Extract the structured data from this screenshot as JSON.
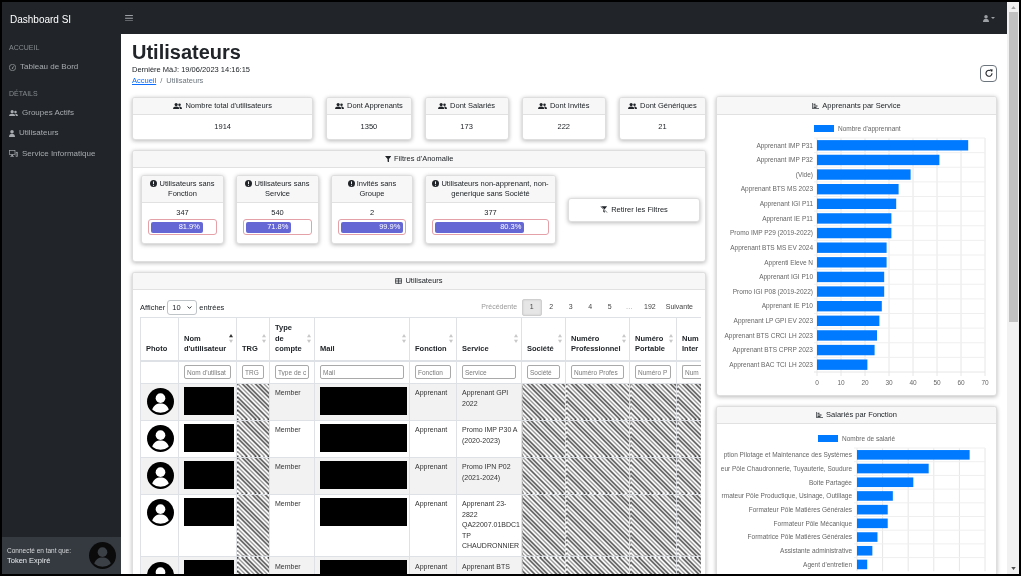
{
  "topbar": {
    "brand": "Dashboard SI"
  },
  "sidebar": {
    "sections": [
      {
        "heading": "ACCUEIL",
        "items": [
          {
            "label": "Tableau de Bord"
          }
        ]
      },
      {
        "heading": "DÉTAILS",
        "items": [
          {
            "label": "Groupes Actifs"
          },
          {
            "label": "Utilisateurs"
          },
          {
            "label": "Service Informatique"
          }
        ]
      }
    ],
    "footer": {
      "caption": "Connecté en tant que:",
      "user": "Token Expiré"
    }
  },
  "header": {
    "title": "Utilisateurs",
    "last_update": "Dernière MàJ: 19/06/2023 14:16:15",
    "breadcrumb": {
      "separator": "/",
      "items": [
        {
          "label": "Accueil",
          "link": true
        },
        {
          "label": "Utilisateurs",
          "link": false
        }
      ]
    }
  },
  "stats": [
    {
      "label": "Nombre total d'utilisateurs",
      "value": "1914"
    },
    {
      "label": "Dont Apprenants",
      "value": "1350"
    },
    {
      "label": "Dont Salariés",
      "value": "173"
    },
    {
      "label": "Dont Invités",
      "value": "222"
    },
    {
      "label": "Dont Génériques",
      "value": "21"
    }
  ],
  "anomaly_filters": {
    "title": "Filtres d'Anomalie",
    "cards": [
      {
        "label": "Utilisateurs sans Fonction",
        "count": "347",
        "level": 0.819,
        "reading": "81.9%"
      },
      {
        "label": "Utilisateurs sans Service",
        "count": "540",
        "level": 0.718,
        "reading": "71.8%"
      },
      {
        "label": "Invités sans Groupe",
        "count": "2",
        "level": 0.999,
        "reading": "99.9%"
      },
      {
        "label": "Utilisateurs non-apprenant, non-generique sans Société",
        "count": "377",
        "level": 0.803,
        "reading": "80.3%"
      }
    ],
    "clear_button": "Retirer les Filtres"
  },
  "users_table": {
    "title": "Utilisateurs",
    "length": {
      "prefix": "Afficher",
      "value": "10",
      "suffix": "entrées"
    },
    "pagination": [
      {
        "label": "Précédente",
        "selected": false,
        "disabled": true
      },
      {
        "label": "1",
        "selected": true,
        "disabled": false
      },
      {
        "label": "2",
        "selected": false,
        "disabled": false
      },
      {
        "label": "3",
        "selected": false,
        "disabled": false
      },
      {
        "label": "4",
        "selected": false,
        "disabled": false
      },
      {
        "label": "5",
        "selected": false,
        "disabled": false
      },
      {
        "label": "…",
        "selected": false,
        "disabled": true
      },
      {
        "label": "192",
        "selected": false,
        "disabled": false
      },
      {
        "label": "Suivante",
        "selected": false,
        "disabled": false
      }
    ],
    "columns": [
      {
        "label": "Photo",
        "kind": "photo"
      },
      {
        "label": "Nom d'utilisateur",
        "kind": "blacked",
        "sorted": true,
        "placeholder": "Nom d'utilisat"
      },
      {
        "label": "TRG",
        "kind": "hatched",
        "sorted": false,
        "placeholder": "TRG"
      },
      {
        "label": "Type de compte",
        "kind": "text",
        "sorted": false,
        "placeholder": "Type de c"
      },
      {
        "label": "Mail",
        "kind": "blacked",
        "sorted": false,
        "placeholder": "Mail"
      },
      {
        "label": "Fonction",
        "kind": "text",
        "sorted": false,
        "placeholder": "Fonction"
      },
      {
        "label": "Service",
        "kind": "text",
        "sorted": false,
        "placeholder": "Service"
      },
      {
        "label": "Société",
        "kind": "hatched",
        "sorted": false,
        "placeholder": "Société"
      },
      {
        "label": "Numéro Professionnel",
        "kind": "hatched",
        "sorted": false,
        "placeholder": "Numéro Profes"
      },
      {
        "label": "Numéro Portable",
        "kind": "hatched",
        "sorted": false,
        "placeholder": "Numéro P"
      },
      {
        "label": "Num Inter",
        "kind": "hatched",
        "placeholder": "Num"
      }
    ],
    "rows": [
      {
        "cells": [
          "Member",
          "Apprenant",
          "Apprenant GPI 2022"
        ]
      },
      {
        "cells": [
          "Member",
          "Apprenant",
          "Promo IMP P30 A (2020-2023)"
        ]
      },
      {
        "cells": [
          "Member",
          "Apprenant",
          "Promo IPN P02 (2021-2024)"
        ]
      },
      {
        "cells": [
          "Member",
          "Apprenant",
          "Apprenant 23-2822 QA22007.01BDC1 TP CHAUDRONNIER"
        ]
      },
      {
        "cells": [
          "Member",
          "Apprenant",
          "Apprenant BTS"
        ]
      }
    ]
  },
  "charts": [
    {
      "chart_data": {
        "type": "bar",
        "orientation": "horizontal",
        "title": "Apprenants par Service",
        "categories": [
          "Apprenant IMP P31",
          "Apprenant IMP P32",
          "(Vide)",
          "Apprenant BTS MS 2023",
          "Apprenant IGI P11",
          "Apprenant IE P11",
          "Promo IMP P29 (2019-2022)",
          "Apprenant BTS MS EV 2024",
          "Apprenti Eleve N",
          "Apprenant IGI P10",
          "Promo IGI P08 (2019-2022)",
          "Apprenant IE P10",
          "Apprenant LP GPI EV 2023",
          "Apprenant BTS CRCI LH 2023",
          "Apprenant BTS CPRP 2023",
          "Apprenant BAC TCI LH 2023"
        ],
        "series": [
          {
            "name": "Nombre d'apprennant",
            "color": "#007bff",
            "values": [
              63,
              51,
              39,
              34,
              33,
              31,
              31,
              29,
              29,
              28,
              28,
              27,
              26,
              25,
              24,
              21
            ]
          }
        ],
        "xlim": [
          0,
          70
        ],
        "xticks": [
          0,
          10,
          20,
          30,
          40,
          50,
          60,
          70
        ],
        "grid": true
      }
    },
    {
      "title": "Salariés par Fonction",
      "legend": "Nombre de salarié",
      "labels": [
        "ption Pilotage et Maintenance des Systèmes",
        "eur Pôle Chaudronnerie, Tuyauterie, Soudure",
        "Boite Partagée",
        "rmateur Pôle Productique, Usinage, Outillage",
        "Formateur Pôle Matières Générales",
        "Formateur Pôle Mécanique",
        "Formatrice Pôle Matières Générales",
        "Assistante administrative",
        "Agent d'entretien"
      ]
    }
  ]
}
